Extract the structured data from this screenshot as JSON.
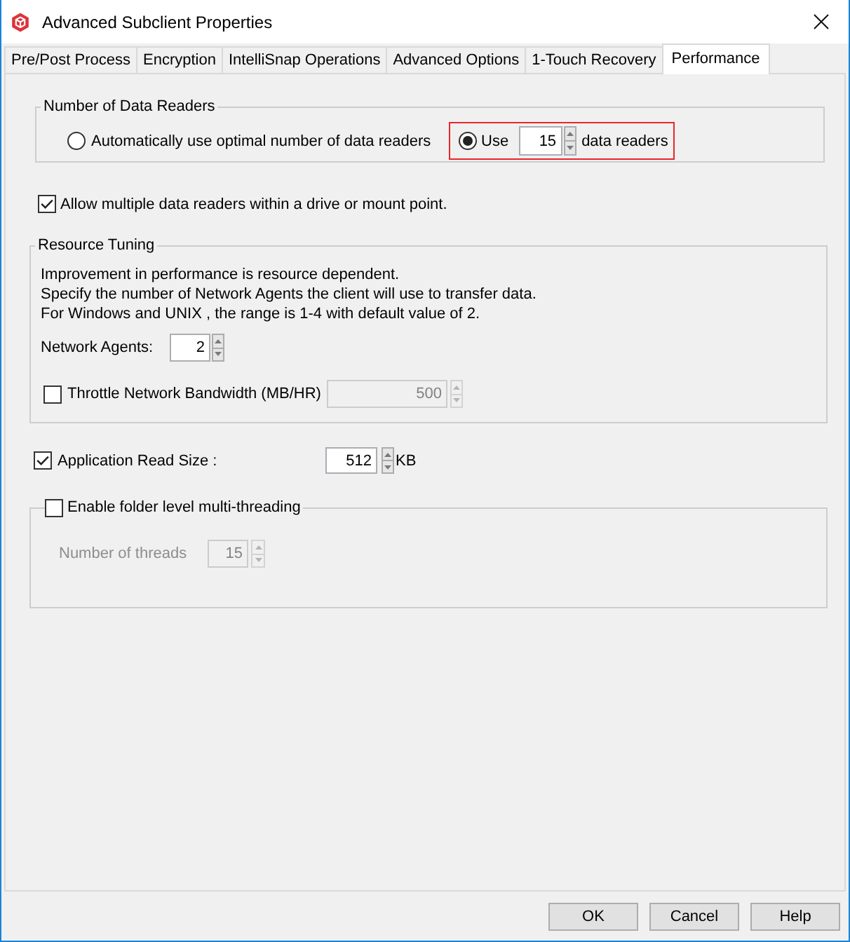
{
  "window": {
    "title": "Advanced Subclient Properties"
  },
  "tabs": [
    {
      "label": "Pre/Post Process",
      "selected": false
    },
    {
      "label": "Encryption",
      "selected": false
    },
    {
      "label": "IntelliSnap Operations",
      "selected": false
    },
    {
      "label": "Advanced Options",
      "selected": false
    },
    {
      "label": "1-Touch Recovery",
      "selected": false
    },
    {
      "label": "Performance",
      "selected": true
    }
  ],
  "data_readers": {
    "title": "Number of Data Readers",
    "options": [
      {
        "kind": "auto",
        "label": "Automatically use optimal number of data readers",
        "selected": false,
        "highlighted": false
      },
      {
        "kind": "count",
        "label": "Use",
        "selected": true,
        "highlighted": true,
        "value": "15",
        "suffix": "data readers"
      }
    ]
  },
  "allow_multiple": {
    "label": "Allow multiple data readers within a drive or mount point.",
    "checked": true
  },
  "resource_tuning": {
    "title": "Resource Tuning",
    "description": [
      "Improvement in performance is resource dependent.",
      "Specify the number of Network Agents the client will use to transfer data.",
      "For Windows and UNIX , the range is 1-4 with default value of 2."
    ],
    "network_agents": {
      "label": "Network Agents:",
      "value": "2"
    },
    "throttle": {
      "label": "Throttle Network Bandwidth (MB/HR)",
      "checked": false,
      "value": "500",
      "disabled": true
    }
  },
  "read_size": {
    "label": "Application Read Size :",
    "checked": true,
    "value": "512",
    "unit": "KB"
  },
  "multithreading": {
    "label": "Enable folder level multi-threading",
    "checked": false,
    "threads": {
      "label": "Number of threads",
      "value": "15",
      "disabled": true
    }
  },
  "buttons": [
    "OK",
    "Cancel",
    "Help"
  ]
}
